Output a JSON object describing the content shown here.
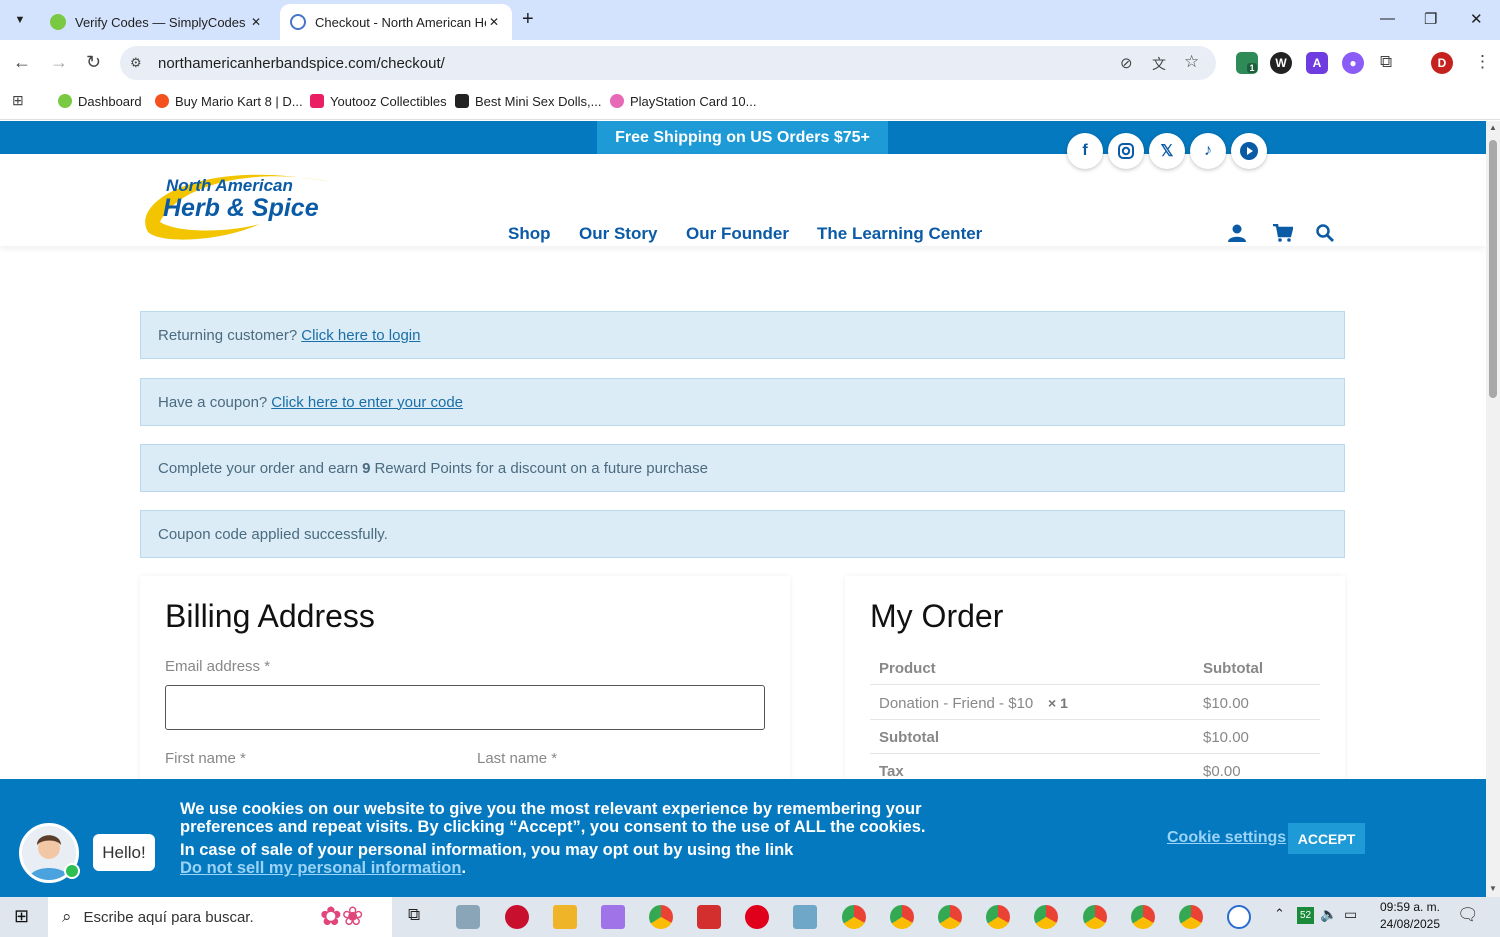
{
  "browser": {
    "tabs": [
      {
        "title": "Verify Codes — SimplyCodes",
        "active": false
      },
      {
        "title": "Checkout - North American Herb",
        "active": true
      }
    ],
    "url": "northamericanherbandspice.com/checkout/",
    "profile_initial": "D",
    "extension_badge": "1",
    "bookmarks": [
      "Dashboard",
      "Buy Mario Kart 8 | D...",
      "Youtooz Collectibles",
      "Best Mini Sex Dolls,...",
      "PlayStation Card 10..."
    ]
  },
  "site": {
    "shipping_banner": "Free Shipping on US Orders $75+",
    "logo_line1": "North American",
    "logo_line2": "Herb & Spice",
    "nav": [
      "Shop",
      "Our Story",
      "Our Founder",
      "The Learning Center"
    ],
    "social_icons": [
      "facebook-icon",
      "instagram-icon",
      "x-icon",
      "tiktok-icon",
      "youtube-icon"
    ]
  },
  "notices": {
    "returning_text": "Returning customer?",
    "returning_link": "Click here to login",
    "coupon_text": "Have a coupon?",
    "coupon_link": "Click here to enter your code",
    "reward_pre": "Complete your order and earn",
    "reward_points": "9",
    "reward_post": "Reward Points for a discount on a future purchase",
    "coupon_applied": "Coupon code applied successfully."
  },
  "billing": {
    "title": "Billing Address",
    "email_label": "Email address",
    "first_name_label": "First name",
    "last_name_label": "Last name",
    "required_mark": "*"
  },
  "order": {
    "title": "My Order",
    "col_product": "Product",
    "col_subtotal": "Subtotal",
    "item_name": "Donation - Friend - $10",
    "item_qty": "× 1",
    "item_price": "$10.00",
    "subtotal_label": "Subtotal",
    "subtotal_value": "$10.00",
    "tax_label": "Tax",
    "tax_value": "$0.00"
  },
  "cookie": {
    "line1": "We use cookies on our website to give you the most relevant experience by remembering your preferences and repeat visits. By clicking “Accept”, you consent to the use of ALL the cookies.",
    "line2": "In case of sale of your personal information, you may opt out by using the link",
    "link": "Do not sell my personal information",
    "link_suffix": ".",
    "settings": "Cookie settings",
    "accept": "ACCEPT"
  },
  "chat": {
    "greeting": "Hello!"
  },
  "taskbar": {
    "search_placeholder": "Escribe aquí para buscar.",
    "time": "09:59 a. m.",
    "date": "24/08/2025",
    "tray_badge": "52"
  },
  "colors": {
    "brand_blue": "#0479c0",
    "nav_blue": "#0b5aa6",
    "accent_blue": "#1e9ad6",
    "notice_bg": "#dcecf6"
  }
}
